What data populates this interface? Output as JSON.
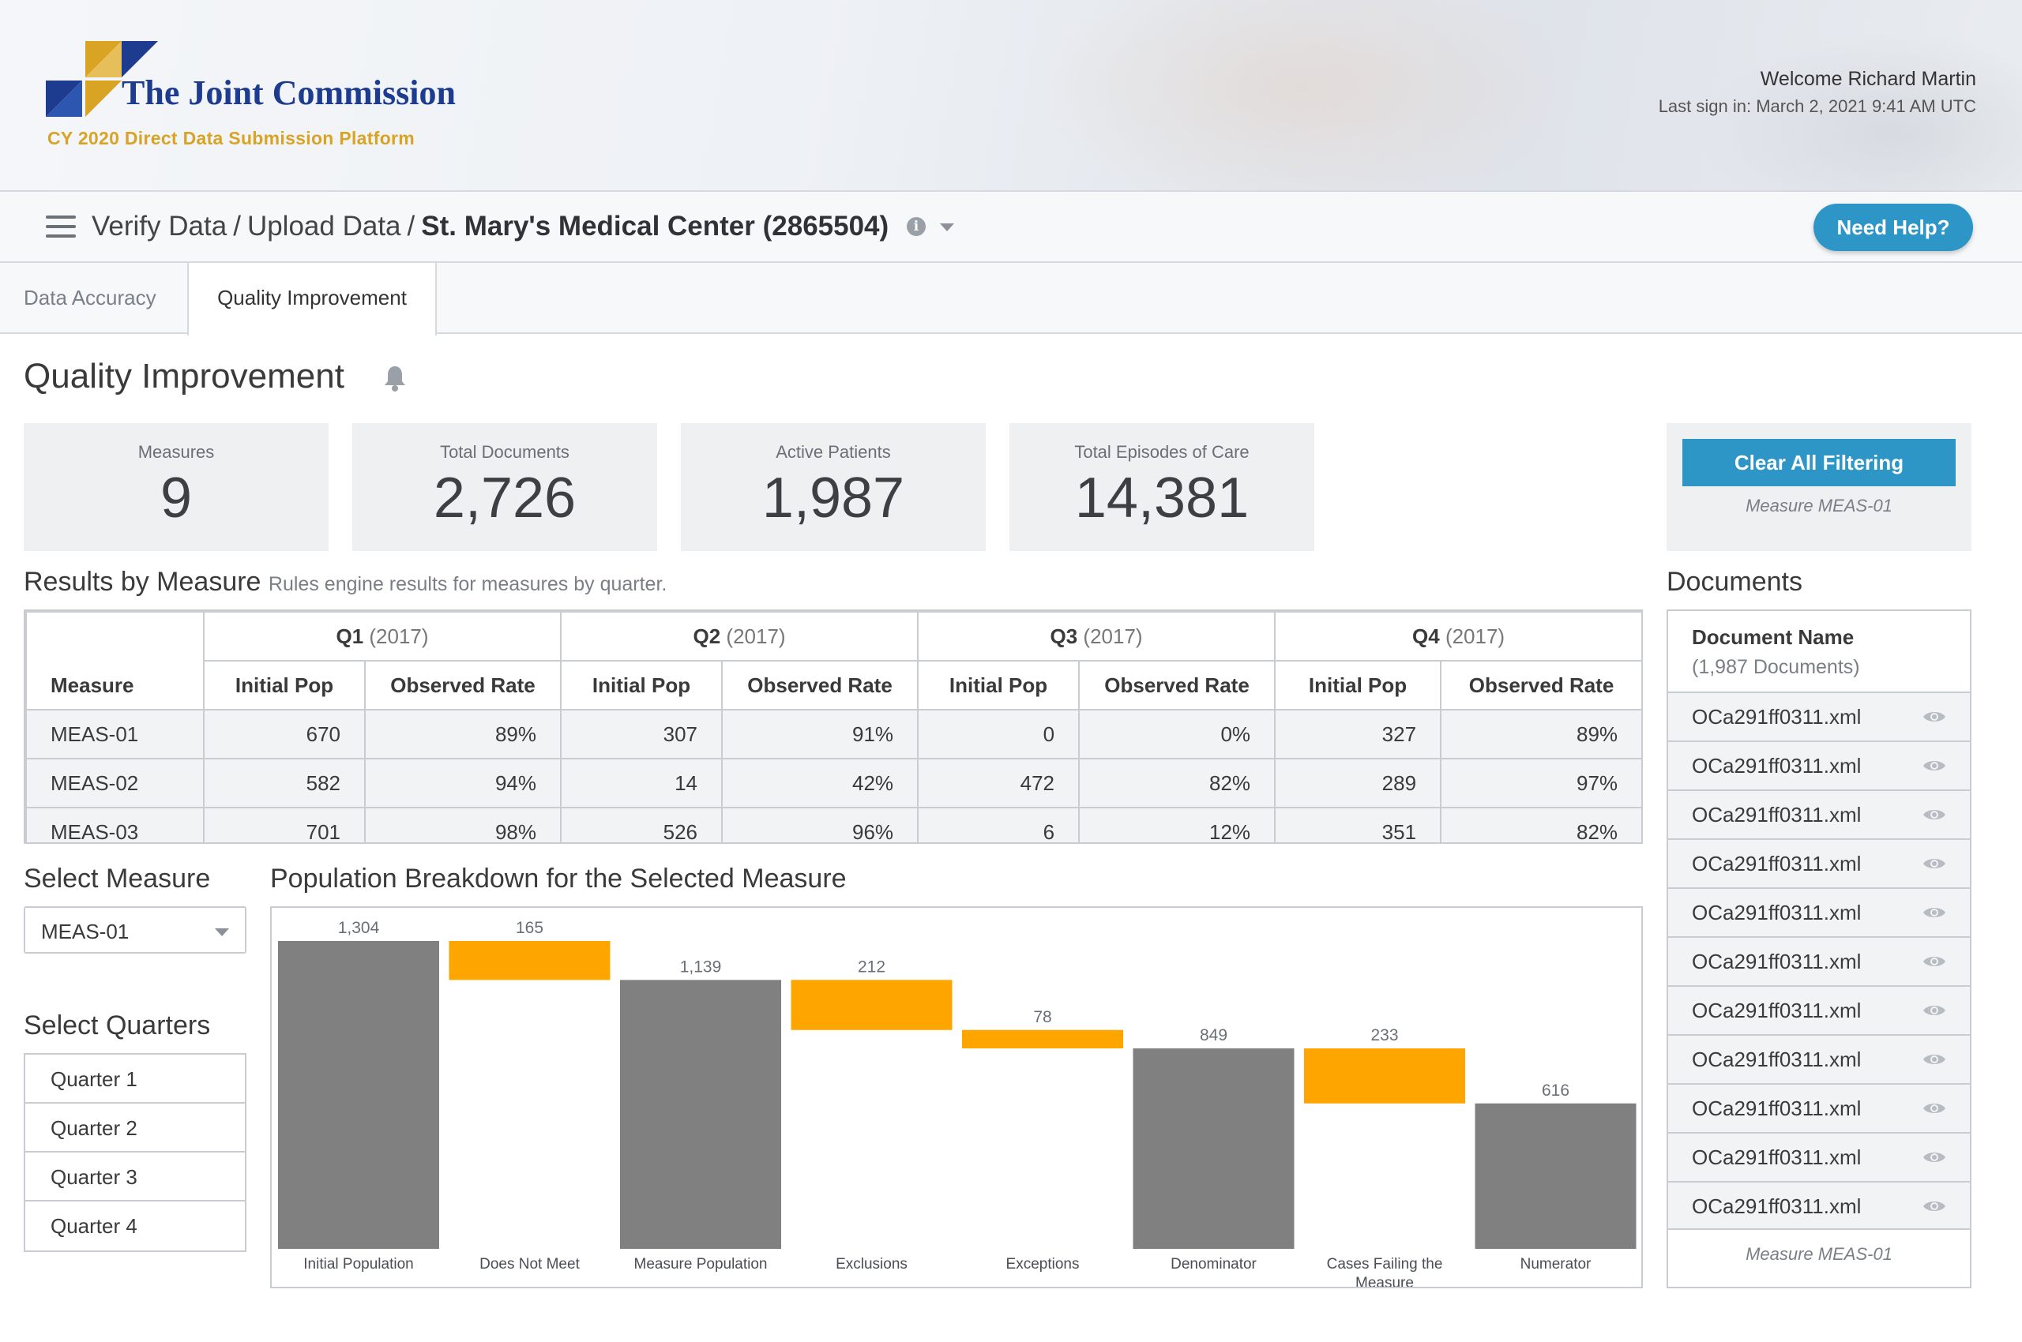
{
  "header": {
    "brand": "The Joint Commission",
    "platform": "CY 2020 Direct Data Submission Platform",
    "welcome": "Welcome Richard Martin",
    "last_sign_in": "Last sign in: March 2, 2021 9:41 AM UTC",
    "colors": {
      "brand_blue": "#1d3c8f",
      "brand_gold": "#d9a324",
      "accent": "#2e95c7"
    }
  },
  "breadcrumb": {
    "items": [
      "Verify Data",
      "Upload Data"
    ],
    "separator": "/",
    "current": "St. Mary's Medical Center (2865504)",
    "info_icon": "info-icon",
    "menu_icon": "hamburger-icon"
  },
  "help_button": "Need Help?",
  "tabs": [
    {
      "label": "Data Accuracy",
      "active": false
    },
    {
      "label": "Quality Improvement",
      "active": true
    }
  ],
  "page": {
    "title": "Quality Improvement",
    "title_icon": "bell-icon"
  },
  "stats": [
    {
      "label": "Measures",
      "value": "9"
    },
    {
      "label": "Total Documents",
      "value": "2,726"
    },
    {
      "label": "Active Patients",
      "value": "1,987"
    },
    {
      "label": "Total Episodes of Care",
      "value": "14,381"
    }
  ],
  "filter": {
    "button": "Clear All Filtering",
    "note": "Measure MEAS-01"
  },
  "results": {
    "title": "Results by Measure",
    "subtitle": "Rules engine results for measures by quarter.",
    "measure_header": "Measure",
    "quarters": [
      {
        "q": "Q1",
        "year": "(2017)"
      },
      {
        "q": "Q2",
        "year": "(2017)"
      },
      {
        "q": "Q3",
        "year": "(2017)"
      },
      {
        "q": "Q4",
        "year": "(2017)"
      }
    ],
    "col_initial": "Initial Pop",
    "col_rate": "Observed Rate",
    "rows": [
      {
        "measure": "MEAS-01",
        "values": [
          "670",
          "89%",
          "307",
          "91%",
          "0",
          "0%",
          "327",
          "89%"
        ]
      },
      {
        "measure": "MEAS-02",
        "values": [
          "582",
          "94%",
          "14",
          "42%",
          "472",
          "82%",
          "289",
          "97%"
        ]
      },
      {
        "measure": "MEAS-03",
        "values": [
          "701",
          "98%",
          "526",
          "96%",
          "6",
          "12%",
          "351",
          "82%"
        ]
      }
    ]
  },
  "select_measure": {
    "label": "Select Measure",
    "value": "MEAS-01"
  },
  "select_quarters": {
    "label": "Select Quarters",
    "items": [
      "Quarter 1",
      "Quarter 2",
      "Quarter 3",
      "Quarter 4"
    ]
  },
  "chart_title": "Population Breakdown for the Selected Measure",
  "chart_data": {
    "type": "bar",
    "subtype": "waterfall",
    "categories": [
      "Initial Population",
      "Does Not Meet",
      "Measure Population",
      "Exclusions",
      "Exceptions",
      "Denominator",
      "Cases Failing the Measure",
      "Numerator"
    ],
    "category_lines": [
      [
        "Initial Population"
      ],
      [
        "Does Not Meet"
      ],
      [
        "Measure Population"
      ],
      [
        "Exclusions"
      ],
      [
        "Exceptions"
      ],
      [
        "Denominator"
      ],
      [
        "Cases Failing the",
        "Measure"
      ],
      [
        "Numerator"
      ]
    ],
    "values": [
      1304,
      165,
      1139,
      212,
      78,
      849,
      233,
      616
    ],
    "labels": [
      "1,304",
      "165",
      "1,139",
      "212",
      "78",
      "849",
      "233",
      "616"
    ],
    "kinds": [
      "total",
      "decrease",
      "total",
      "decrease",
      "decrease",
      "total",
      "decrease",
      "total"
    ],
    "colors": {
      "total": "#808080",
      "decrease": "#ffa500"
    },
    "ylim": [
      0,
      1304
    ],
    "grid": false
  },
  "documents": {
    "title": "Documents",
    "header": "Document Name",
    "count": "(1,987 Documents)",
    "items": [
      "OCa291ff0311.xml",
      "OCa291ff0311.xml",
      "OCa291ff0311.xml",
      "OCa291ff0311.xml",
      "OCa291ff0311.xml",
      "OCa291ff0311.xml",
      "OCa291ff0311.xml",
      "OCa291ff0311.xml",
      "OCa291ff0311.xml",
      "OCa291ff0311.xml",
      "OCa291ff0311.xml"
    ],
    "row_icon": "eye-icon",
    "footer": "Measure MEAS-01"
  }
}
